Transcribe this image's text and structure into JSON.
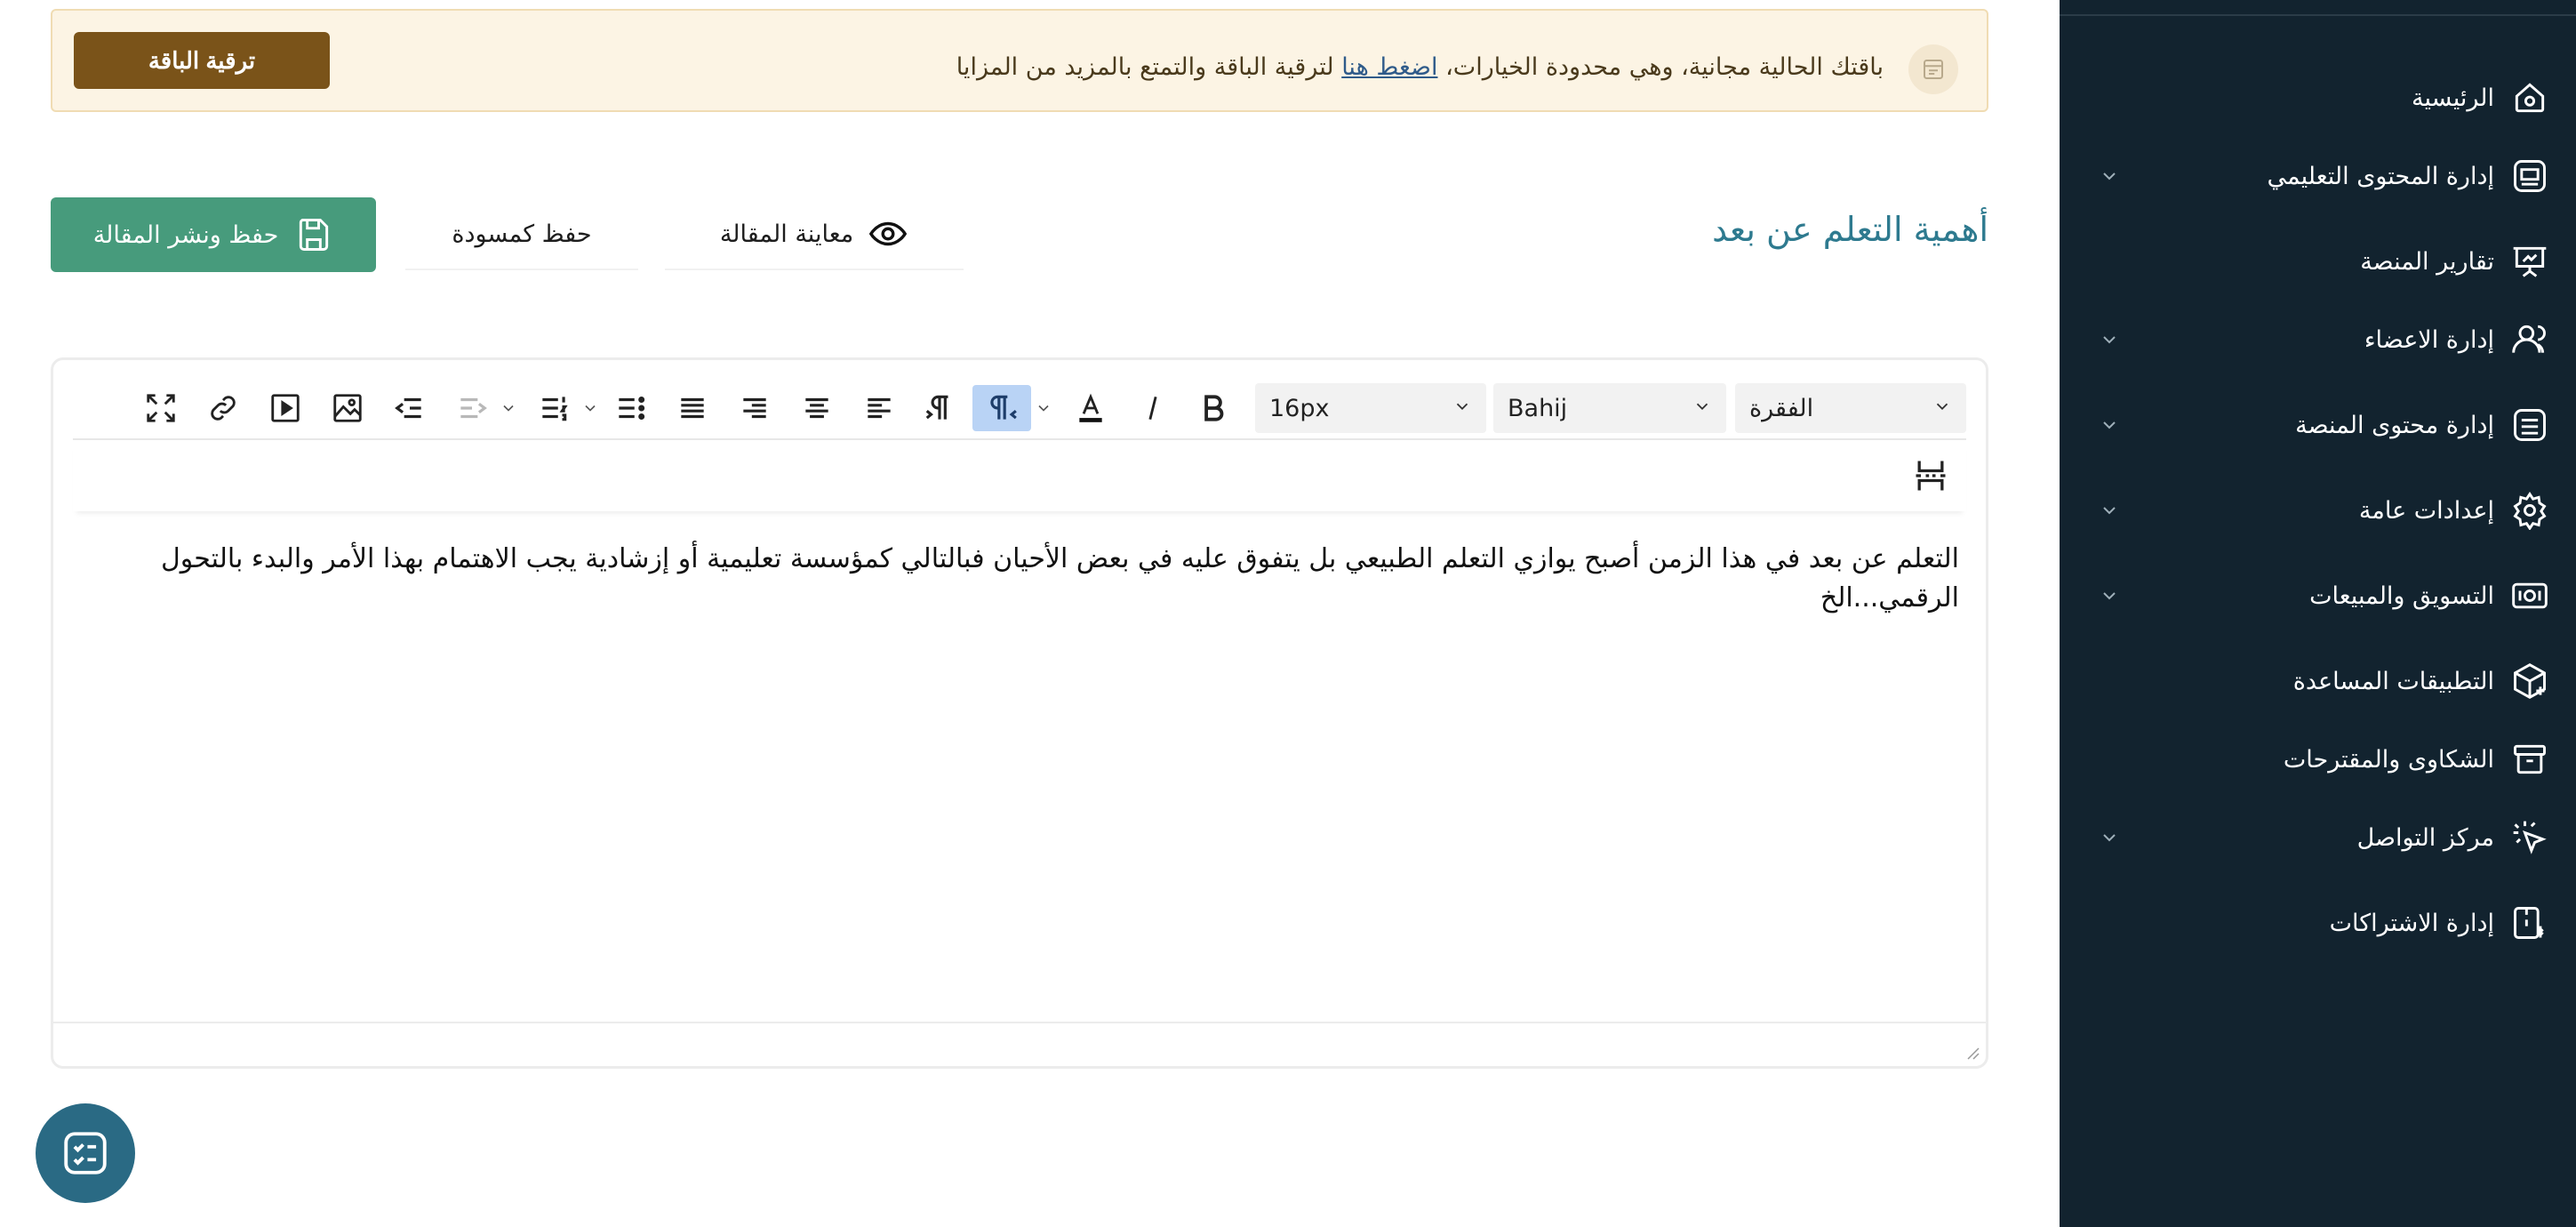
{
  "banner": {
    "text_before": "باقتك الحالية مجانية، وهي محدودة الخيارات،",
    "link": "اضغط هنا",
    "text_after": "لترقية الباقة والتمتع بالمزيد من المزايا",
    "upgrade_label": "ترقية الباقة",
    "icon": "store-icon"
  },
  "header": {
    "title": "أهمية التعلم عن بعد",
    "preview_label": "معاينة المقالة",
    "draft_label": "حفظ كمسودة",
    "publish_label": "حفظ ونشر المقالة"
  },
  "editor": {
    "block_format": "الفقرة",
    "font_family": "Bahij",
    "font_size": "16px",
    "content": "التعلم عن بعد في هذا الزمن أصبح يوازي التعلم الطبيعي بل يتفوق عليه في بعض الأحيان فبالتالي كمؤسسة تعليمية أو إزشادية يجب الاهتمام بهذا الأمر والبدء بالتحول الرقمي...الخ"
  },
  "sidebar": {
    "items": [
      {
        "label": "الرئيسية",
        "icon": "home-icon",
        "expandable": false
      },
      {
        "label": "إدارة المحتوى التعليمي",
        "icon": "content-icon",
        "expandable": true
      },
      {
        "label": "تقارير المنصة",
        "icon": "presentation-icon",
        "expandable": false
      },
      {
        "label": "إدارة الاعضاء",
        "icon": "users-icon",
        "expandable": true
      },
      {
        "label": "إدارة محتوى المنصة",
        "icon": "list-icon",
        "expandable": true
      },
      {
        "label": "إعدادات عامة",
        "icon": "gear-icon",
        "expandable": true
      },
      {
        "label": "التسويق والمبيعات",
        "icon": "money-icon",
        "expandable": true
      },
      {
        "label": "التطبيقات المساعدة",
        "icon": "package-icon",
        "expandable": false
      },
      {
        "label": "الشكاوى والمقترحات",
        "icon": "archive-icon",
        "expandable": false
      },
      {
        "label": "مركز التواصل",
        "icon": "pointer-icon",
        "expandable": true
      },
      {
        "label": "إدارة الاشتراكات",
        "icon": "subscription-icon",
        "expandable": false
      }
    ]
  },
  "colors": {
    "sidebar_bg": "#12232f",
    "primary_green": "#479b7c",
    "upgrade_brown": "#7a5319",
    "title_teal": "#2e7a8f"
  }
}
